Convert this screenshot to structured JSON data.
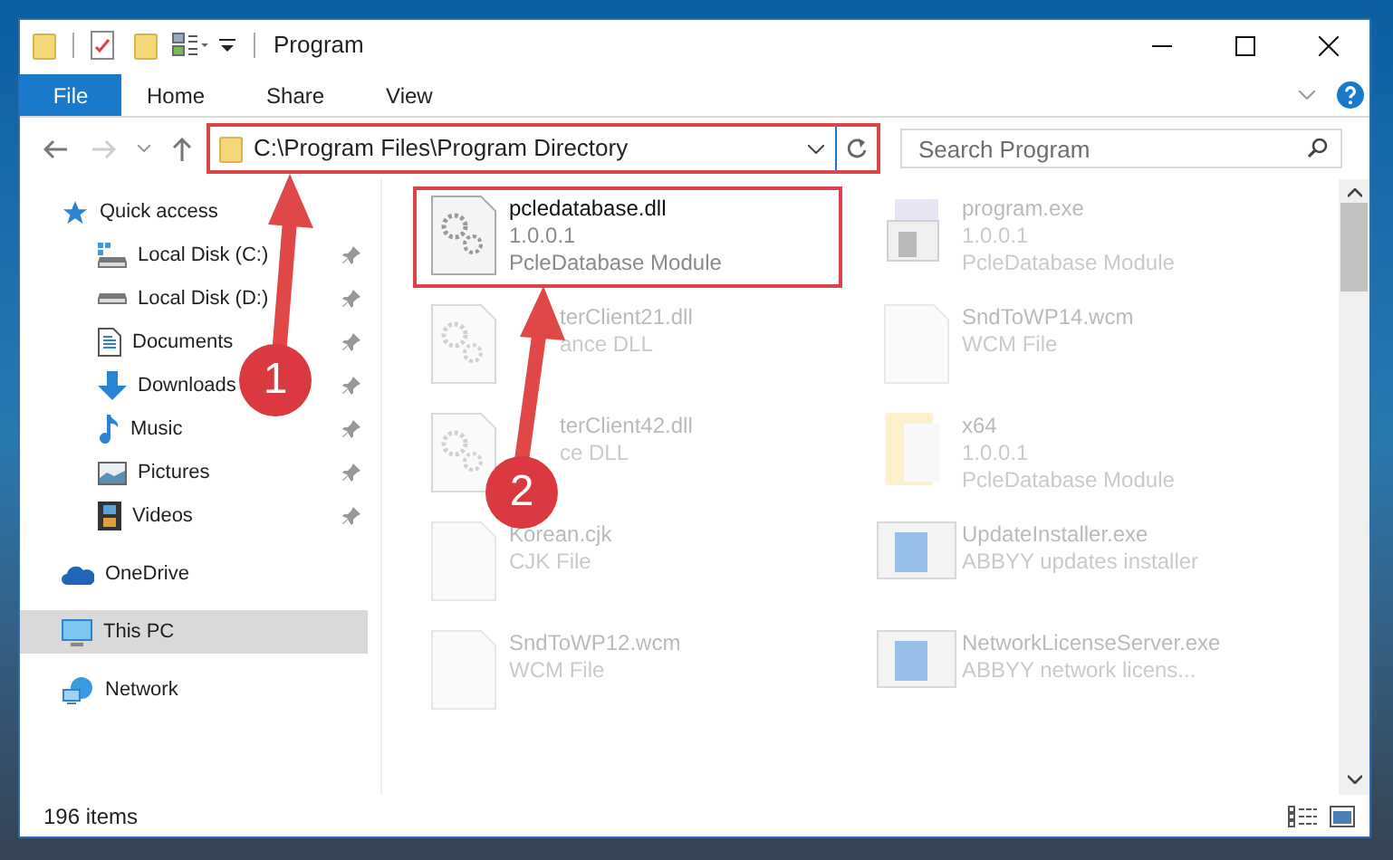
{
  "window": {
    "title": "Program"
  },
  "ribbon_tabs": [
    {
      "label": "File",
      "selected": true
    },
    {
      "label": "Home",
      "selected": false
    },
    {
      "label": "Share",
      "selected": false
    },
    {
      "label": "View",
      "selected": false
    }
  ],
  "address_bar": {
    "path": "C:\\Program Files\\Program Directory",
    "highlighted": true
  },
  "search": {
    "placeholder": "Search Program"
  },
  "nav_pane": [
    {
      "label": "Quick access",
      "kind": "quick",
      "selected": false,
      "pinned": false,
      "children": [
        {
          "label": "Local Disk (C:)",
          "kind": "system-drive",
          "selected": false,
          "pinned": true
        },
        {
          "label": "Local Disk (D:)",
          "kind": "drive",
          "selected": false,
          "pinned": true
        },
        {
          "label": "Documents",
          "kind": "documents",
          "selected": false,
          "pinned": true
        },
        {
          "label": "Downloads",
          "kind": "downloads",
          "selected": false,
          "pinned": true
        },
        {
          "label": "Music",
          "kind": "music",
          "selected": false,
          "pinned": true
        },
        {
          "label": "Pictures",
          "kind": "pictures",
          "selected": false,
          "pinned": true
        },
        {
          "label": "Videos",
          "kind": "videos",
          "selected": false,
          "pinned": true
        }
      ]
    },
    {
      "label": "OneDrive",
      "kind": "cloud",
      "selected": false,
      "pinned": false
    },
    {
      "label": "This PC",
      "kind": "pc",
      "selected": true,
      "pinned": false
    },
    {
      "label": "Network",
      "kind": "network",
      "selected": false,
      "pinned": false
    }
  ],
  "files": [
    {
      "name": "pcledatabase.dll",
      "lines": [
        "1.0.0.1",
        "PcleDatabase Module"
      ],
      "kind": "dll",
      "blurred": false,
      "highlighted": true
    },
    {
      "name": "program.exe",
      "lines": [
        "1.0.0.1",
        "PcleDatabase Module"
      ],
      "kind": "exe",
      "blurred": true,
      "highlighted": false
    },
    {
      "name": "terClient21.dll",
      "lines": [
        "ance DLL"
      ],
      "kind": "dll",
      "blurred": true,
      "highlighted": false,
      "partly_covered": true
    },
    {
      "name": "SndToWP14.wcm",
      "lines": [
        "WCM File"
      ],
      "kind": "file",
      "blurred": true,
      "highlighted": false
    },
    {
      "name": "terClient42.dll",
      "lines": [
        "ce DLL"
      ],
      "kind": "dll",
      "blurred": true,
      "highlighted": false,
      "partly_covered": true
    },
    {
      "name": "x64",
      "lines": [
        "1.0.0.1",
        "PcleDatabase Module"
      ],
      "kind": "folder",
      "blurred": true,
      "highlighted": false
    },
    {
      "name": "Korean.cjk",
      "lines": [
        "CJK File"
      ],
      "kind": "file",
      "blurred": true,
      "highlighted": false
    },
    {
      "name": "UpdateInstaller.exe",
      "lines": [
        "ABBYY updates installer"
      ],
      "kind": "installer",
      "blurred": true,
      "highlighted": false
    },
    {
      "name": "SndToWP12.wcm",
      "lines": [
        "WCM File"
      ],
      "kind": "file",
      "blurred": true,
      "highlighted": false
    },
    {
      "name": "NetworkLicenseServer.exe",
      "lines": [
        "ABBYY network licens..."
      ],
      "kind": "installer",
      "blurred": true,
      "highlighted": false
    }
  ],
  "callouts": [
    {
      "number": "1"
    },
    {
      "number": "2"
    }
  ],
  "status_bar": {
    "item_count": "196 items"
  }
}
